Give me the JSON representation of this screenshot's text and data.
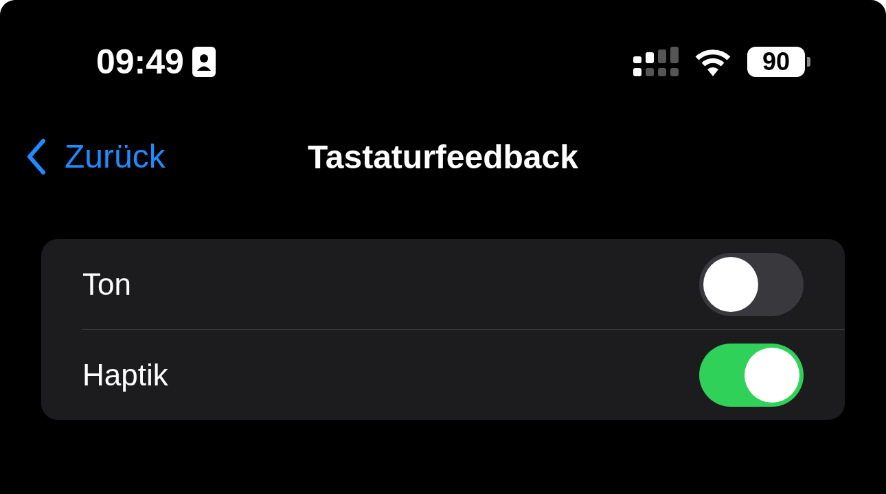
{
  "status_bar": {
    "time": "09:49",
    "battery": "90"
  },
  "nav": {
    "back": "Zurück",
    "title": "Tastaturfeedback"
  },
  "settings": [
    {
      "label": "Ton",
      "on": false
    },
    {
      "label": "Haptik",
      "on": true
    }
  ]
}
